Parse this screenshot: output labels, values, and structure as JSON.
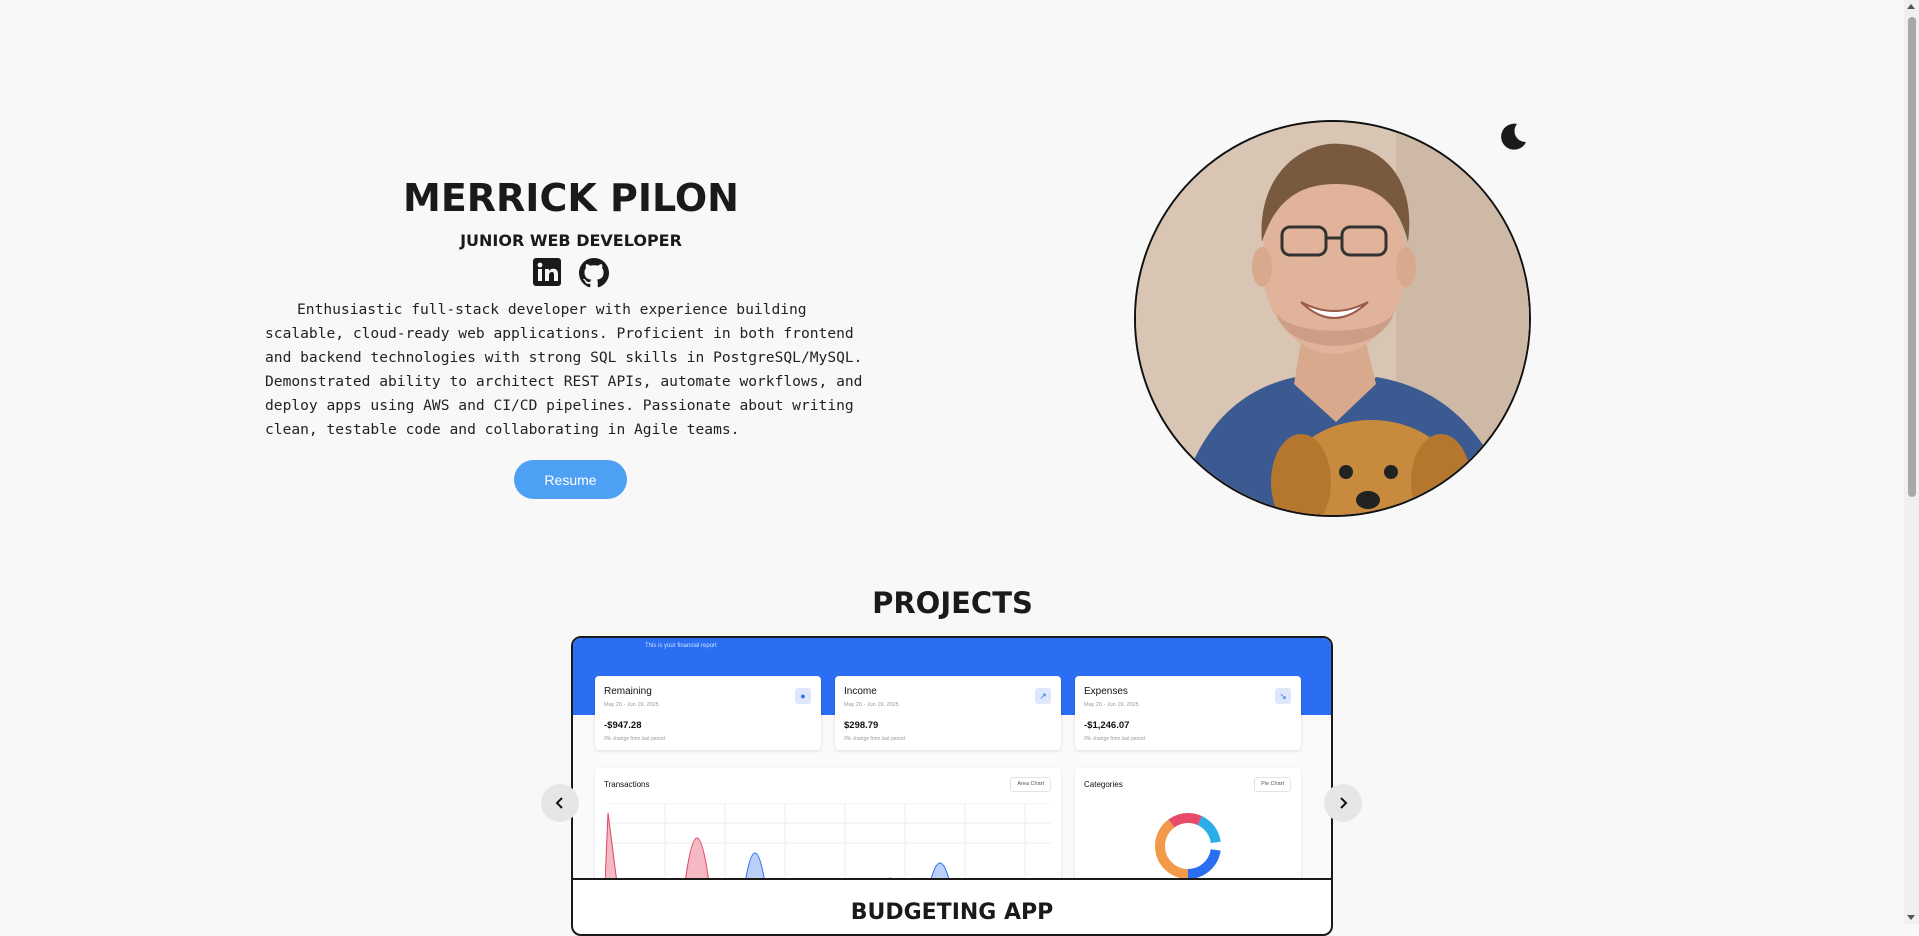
{
  "hero": {
    "name": "MERRICK PILON",
    "role": "JUNIOR WEB DEVELOPER",
    "bio": "Enthusiastic full-stack developer with experience building scalable, cloud-ready web applications. Proficient in both frontend and backend technologies with strong SQL skills in PostgreSQL/MySQL. Demonstrated ability to architect REST APIs, automate workflows, and deploy apps using AWS and CI/CD pipelines. Passionate about writing clean, testable code and collaborating in Agile teams.",
    "resume_label": "Resume",
    "socials": [
      {
        "icon": "linkedin-icon"
      },
      {
        "icon": "github-icon"
      }
    ]
  },
  "theme_toggle": {
    "icon": "moon-icon"
  },
  "projects": {
    "title": "PROJECTS",
    "current": {
      "title": "BUDGETING APP",
      "screenshot": {
        "header_text": "This is your financial report",
        "kpis": [
          {
            "title": "Remaining",
            "date": "May 20 - Jun 19, 2025",
            "value": "-$947.28",
            "note": "0% change from last period"
          },
          {
            "title": "Income",
            "date": "May 20 - Jun 19, 2025",
            "value": "$298.79",
            "note": "0% change from last period"
          },
          {
            "title": "Expenses",
            "date": "May 20 - Jun 19, 2025",
            "value": "-$1,246.07",
            "note": "0% change from last period"
          }
        ],
        "transactions": {
          "title": "Transactions",
          "selector": "Area Chart"
        },
        "categories": {
          "title": "Categories",
          "selector": "Pie Chart"
        }
      }
    },
    "nav": {
      "prev_icon": "chevron-left-icon",
      "next_icon": "chevron-right-icon"
    }
  },
  "colors": {
    "accent": "#4ea0f5",
    "brand_blue": "#2a6ff2",
    "text": "#1a1a1a",
    "background": "#f8f8f8"
  }
}
